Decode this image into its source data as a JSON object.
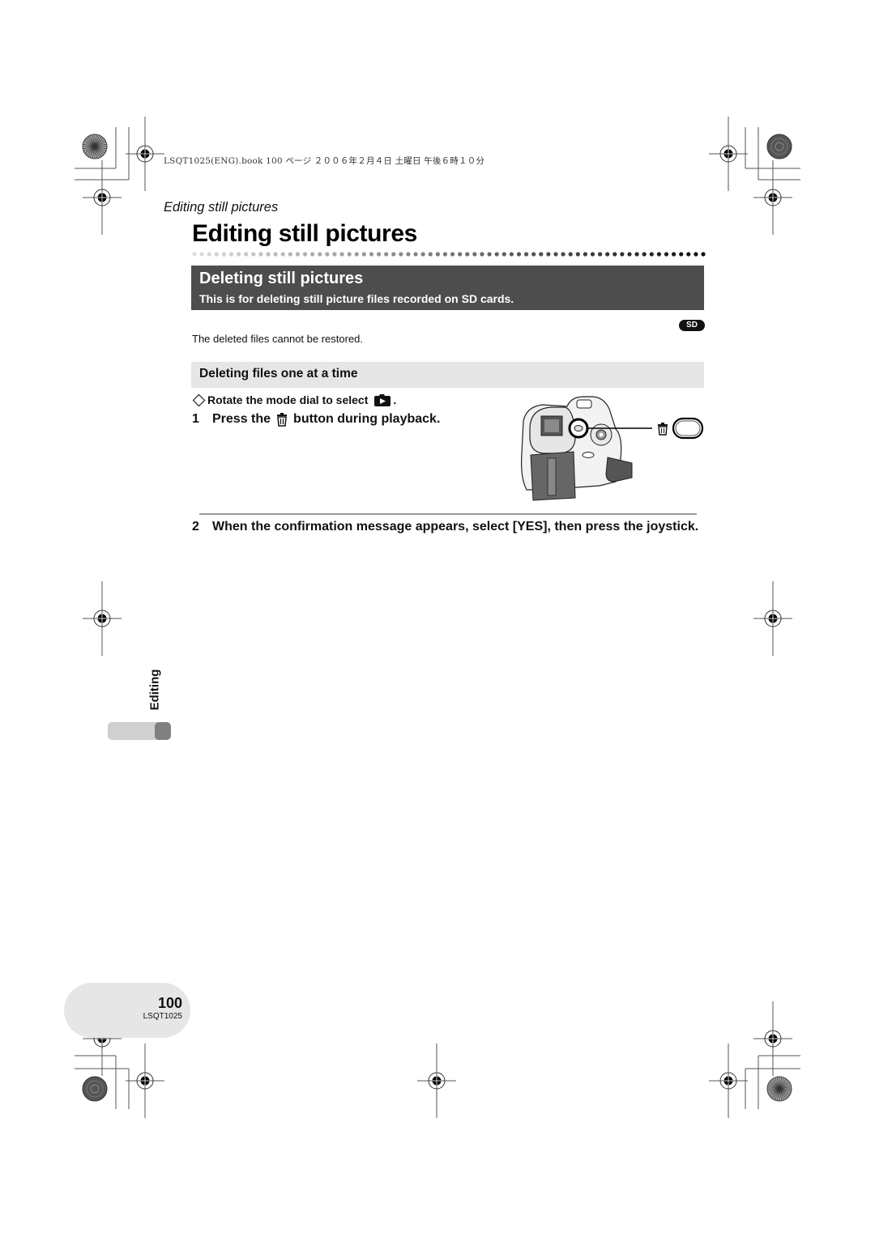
{
  "print_header": "LSQT1025(ENG).book  100 ページ  ２００６年２月４日  土曜日  午後６時１０分",
  "running_head": "Editing still pictures",
  "page_title": "Editing still pictures",
  "section": {
    "title": "Deleting still pictures",
    "subtitle": "This is for deleting still picture files recorded on SD cards."
  },
  "badge": "SD",
  "note": "The deleted files cannot be restored.",
  "subsection": {
    "title": "Deleting files one at a time"
  },
  "pre_step": {
    "bullet_icon": "diamond-outline-icon",
    "text": "Rotate the mode dial to select",
    "mode_icon": "playback-mode-icon",
    "suffix": "."
  },
  "steps": [
    {
      "number": "1",
      "before": "Press the",
      "icon": "trash-icon",
      "after": "button during playback."
    },
    {
      "number": "2",
      "text": "When the confirmation message appears, select [YES], then press the joystick."
    }
  ],
  "illustration": {
    "subject": "camcorder-rear-view",
    "callout_icon": "trash-icon",
    "callout_button": "delete-button"
  },
  "side_tab": {
    "label": "Editing"
  },
  "footer": {
    "page_number": "100",
    "code": "LSQT1025"
  }
}
